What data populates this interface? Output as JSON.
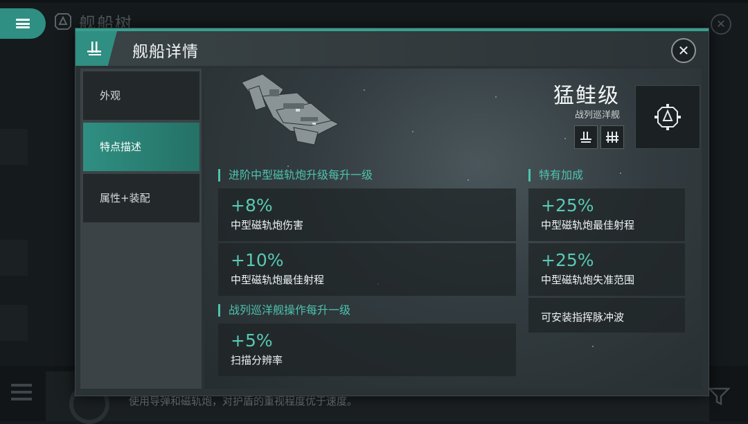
{
  "background": {
    "title": "舰船树",
    "description": "使用导弹和磁轨炮，对护盾的重视程度优于速度。"
  },
  "modal": {
    "title": "舰船详情",
    "tabs": [
      {
        "label": "外观"
      },
      {
        "label": "特点描述"
      },
      {
        "label": "属性+装配"
      }
    ],
    "active_tab": "特点描述"
  },
  "ship": {
    "name": "猛鲑级",
    "class": "战列巡洋舰"
  },
  "sections": {
    "left_1": {
      "title": "进阶中型磁轨炮升级每升一级",
      "items": [
        {
          "value": "+8%",
          "label": "中型磁轨炮伤害"
        },
        {
          "value": "+10%",
          "label": "中型磁轨炮最佳射程"
        }
      ]
    },
    "left_2": {
      "title": "战列巡洋舰操作每升一级",
      "items": [
        {
          "value": "+5%",
          "label": "扫描分辨率"
        }
      ]
    },
    "right": {
      "title": "特有加成",
      "items": [
        {
          "value": "+25%",
          "label": "中型磁轨炮最佳射程"
        },
        {
          "value": "+25%",
          "label": "中型磁轨炮失准范围"
        },
        {
          "label": "可安装指挥脉冲波"
        }
      ]
    }
  },
  "colors": {
    "accent": "#2f8f82",
    "highlight_text": "#59c9b4"
  }
}
